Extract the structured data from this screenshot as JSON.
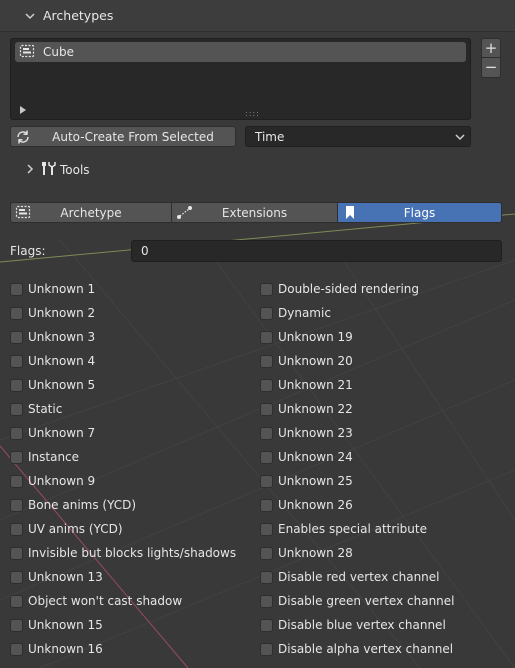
{
  "panel": {
    "title": "Archetypes"
  },
  "archetype_list": {
    "items": [
      {
        "label": "Cube"
      }
    ],
    "add_label": "+",
    "remove_label": "−",
    "grip_label": "::::"
  },
  "auto_create": {
    "label": "Auto-Create From Selected"
  },
  "time_select": {
    "value": "Time"
  },
  "tools": {
    "label": "Tools"
  },
  "tabs": [
    {
      "label": "Archetype",
      "icon": "archetype-icon",
      "active": false
    },
    {
      "label": "Extensions",
      "icon": "extensions-icon",
      "active": false
    },
    {
      "label": "Flags",
      "icon": "bookmark-icon",
      "active": true
    }
  ],
  "flags": {
    "label": "Flags:",
    "value": "0"
  },
  "checkboxes_left": [
    {
      "label": "Unknown 1",
      "checked": false
    },
    {
      "label": "Unknown 2",
      "checked": false
    },
    {
      "label": "Unknown 3",
      "checked": false
    },
    {
      "label": "Unknown 4",
      "checked": false
    },
    {
      "label": "Unknown 5",
      "checked": false
    },
    {
      "label": "Static",
      "checked": false
    },
    {
      "label": "Unknown 7",
      "checked": false
    },
    {
      "label": "Instance",
      "checked": false
    },
    {
      "label": "Unknown 9",
      "checked": false
    },
    {
      "label": "Bone anims (YCD)",
      "checked": false
    },
    {
      "label": "UV anims (YCD)",
      "checked": false
    },
    {
      "label": "Invisible but blocks lights/shadows",
      "checked": false
    },
    {
      "label": "Unknown 13",
      "checked": false
    },
    {
      "label": "Object won't cast shadow",
      "checked": false
    },
    {
      "label": "Unknown 15",
      "checked": false
    },
    {
      "label": "Unknown 16",
      "checked": false
    }
  ],
  "checkboxes_right": [
    {
      "label": "Double-sided rendering",
      "checked": false
    },
    {
      "label": "Dynamic",
      "checked": false
    },
    {
      "label": "Unknown 19",
      "checked": false
    },
    {
      "label": "Unknown 20",
      "checked": false
    },
    {
      "label": "Unknown 21",
      "checked": false
    },
    {
      "label": "Unknown 22",
      "checked": false
    },
    {
      "label": "Unknown 23",
      "checked": false
    },
    {
      "label": "Unknown 24",
      "checked": false
    },
    {
      "label": "Unknown 25",
      "checked": false
    },
    {
      "label": "Unknown 26",
      "checked": false
    },
    {
      "label": "Enables special attribute",
      "checked": false
    },
    {
      "label": "Unknown 28",
      "checked": false
    },
    {
      "label": "Disable red vertex channel",
      "checked": false
    },
    {
      "label": "Disable green vertex channel",
      "checked": false
    },
    {
      "label": "Disable blue vertex channel",
      "checked": false
    },
    {
      "label": "Disable alpha vertex channel",
      "checked": false
    }
  ],
  "colors": {
    "active_tab": "#4772b3",
    "panel_bg": "#393939",
    "field_bg": "#282828",
    "button_bg": "#545454"
  }
}
